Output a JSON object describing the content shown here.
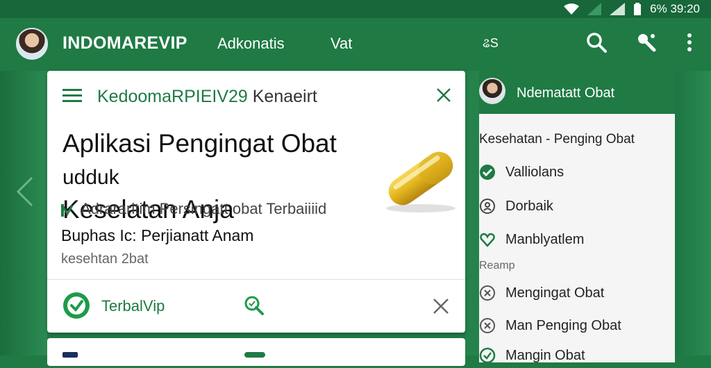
{
  "status_bar": {
    "text": "6% 39:20",
    "icons": [
      "wifi-icon",
      "signal-icon",
      "signal-icon",
      "battery-icon"
    ]
  },
  "app_bar": {
    "title": "INDOMAREVIP",
    "nav": [
      "Adkonatis",
      "Vat"
    ],
    "badge": "ଌS",
    "actions": [
      "search-icon",
      "share-icon",
      "more-vert-icon"
    ]
  },
  "card": {
    "header_accent": "KedoomaRPIEIV29",
    "header_rest": " Kenaeirt",
    "headline_line1": "Aplikasi Pengingat Obat",
    "headline_extra": "udduk",
    "headline_line2": "Keselatan Anja",
    "subtitle": "Adrararitim Persingatt obat Terbaiiiid",
    "body_line1": "Buphas Ic: Perjianatt Anam",
    "body_line2": "kesehtan 2bat",
    "footer_label": "TerbalVip",
    "icons": [
      "menu-icon",
      "close-icon",
      "capsule-icon",
      "check-circle-icon",
      "search-icon",
      "close-icon"
    ]
  },
  "side_panel": {
    "header_title": "Ndematatt Obat",
    "section_title": "Kesehatan - Penging Obat",
    "items": [
      {
        "label": "Valliolans",
        "icon": "check-circle-icon"
      },
      {
        "label": "Dorbaik",
        "icon": "person-circle-icon"
      },
      {
        "label": "Manblyatlem",
        "icon": "heart-icon"
      }
    ],
    "sub_heading": "Reamp",
    "items2": [
      {
        "label": "Mengingat Obat",
        "icon": "close-circle-icon"
      },
      {
        "label": "Man Penging Obat",
        "icon": "close-circle-icon"
      },
      {
        "label": "Mangin Obat",
        "icon": "check-circle-icon"
      }
    ]
  },
  "colors": {
    "brand_green": "#1f7a44",
    "status_bar": "#17673a",
    "card_bg": "#ffffff",
    "panel_bg": "#f4f5f4",
    "capsule": "#e3b41c"
  }
}
